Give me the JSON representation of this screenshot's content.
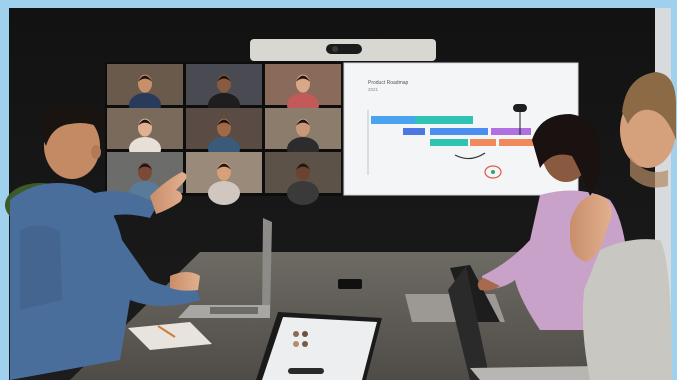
{
  "frame": {
    "border_color": "#9fd0ee"
  },
  "whiteboard": {
    "title": "Product Roadmap",
    "subtitle": "2021",
    "bar_colors": [
      "#4aa3f0",
      "#2fc4b2",
      "#8a6ff0",
      "#b070e0",
      "#f08a5a",
      "#e05a4a"
    ]
  },
  "video_grid": {
    "rows": 3,
    "columns": 3,
    "tile_count": 9
  },
  "devices": [
    "ceiling-camera-bar",
    "laptop-left",
    "laptop-center-right",
    "laptop-right",
    "tablet",
    "notebook",
    "phone"
  ],
  "people": [
    "man-pointing-left",
    "woman-seated-pink-sweater",
    "man-right-foreground"
  ]
}
